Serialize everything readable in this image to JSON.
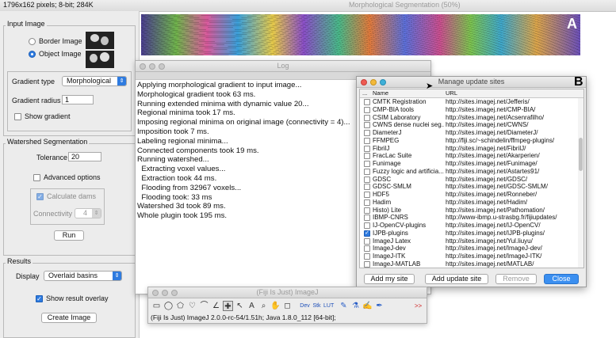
{
  "image_window": {
    "info_bar": "1796x162 pixels; 8-bit; 284K",
    "title": "Morphological Segmentation (50%)",
    "panel_letter": "A"
  },
  "input_image": {
    "section_title": "Input Image",
    "border_image_label": "Border Image",
    "object_image_label": "Object Image",
    "selected": "Object Image",
    "gradient_type_label": "Gradient type",
    "gradient_type_value": "Morphological",
    "gradient_radius_label": "Gradient radius",
    "gradient_radius_value": "1",
    "show_gradient_label": "Show gradient",
    "show_gradient_checked": false
  },
  "watershed": {
    "section_title": "Watershed Segmentation",
    "tolerance_label": "Tolerance",
    "tolerance_value": "20",
    "advanced_options_label": "Advanced options",
    "advanced_options_checked": false,
    "calculate_dams_label": "Calculate dams",
    "calculate_dams_checked": true,
    "connectivity_label": "Connectivity",
    "connectivity_value": "4",
    "run_label": "Run"
  },
  "results": {
    "section_title": "Results",
    "display_label": "Display",
    "display_value": "Overlaid basins",
    "show_overlay_label": "Show result overlay",
    "show_overlay_checked": true,
    "create_image_label": "Create Image"
  },
  "log_window": {
    "title": "Log",
    "lines": [
      "Applying morphological gradient to input image...",
      "Morphological gradient took 63 ms.",
      "Running extended minima with dynamic value 20...",
      "Regional minima took 17 ms.",
      "Imposing regional minima on original image (connectivity = 4)...",
      "Imposition took 7 ms.",
      "Labeling regional minima...",
      "Connected components took 19 ms.",
      "Running watershed...",
      "  Extracting voxel values...",
      "  Extraction took 44 ms.",
      "  Flooding from 32967 voxels...",
      "  Flooding took: 33 ms",
      "Watershed 3d took 89 ms.",
      "Whole plugin took 195 ms."
    ]
  },
  "update_sites": {
    "title": "Manage update sites",
    "panel_letter": "B",
    "col_check": "...",
    "col_name": "Name",
    "col_url": "URL",
    "rows": [
      {
        "name": "CMTK Registration",
        "url": "http://sites.imagej.net/Jefferis/",
        "checked": false
      },
      {
        "name": "CMP-BIA tools",
        "url": "http://sites.imagej.net/CMP-BIA/",
        "checked": false
      },
      {
        "name": "CSIM Laboratory",
        "url": "http://sites.imagej.net/Acsenrafilho/",
        "checked": false
      },
      {
        "name": "CWNS dense nuclei seg...",
        "url": "http://sites.imagej.net/CWNS/",
        "checked": false
      },
      {
        "name": "DiameterJ",
        "url": "http://sites.imagej.net/DiameterJ/",
        "checked": false
      },
      {
        "name": "FFMPEG",
        "url": "http://fiji.sc/~schindelin/ffmpeg-plugins/",
        "checked": false
      },
      {
        "name": "FibrilJ",
        "url": "http://sites.imagej.net/FibrilJ/",
        "checked": false
      },
      {
        "name": "FracLac Suite",
        "url": "http://sites.imagej.net/Akarperien/",
        "checked": false
      },
      {
        "name": "Funimage",
        "url": "http://sites.imagej.net/Funimage/",
        "checked": false
      },
      {
        "name": "Fuzzy logic and artificia...",
        "url": "http://sites.imagej.net/Astartes91/",
        "checked": false
      },
      {
        "name": "GDSC",
        "url": "http://sites.imagej.net/GDSC/",
        "checked": false
      },
      {
        "name": "GDSC-SMLM",
        "url": "http://sites.imagej.net/GDSC-SMLM/",
        "checked": false
      },
      {
        "name": "HDF5",
        "url": "http://sites.imagej.net/Ronneber/",
        "checked": false
      },
      {
        "name": "Hadim",
        "url": "http://sites.imagej.net/Hadim/",
        "checked": false
      },
      {
        "name": "Histo) Lite",
        "url": "http://sites.imagej.net/Pathomation/",
        "checked": false
      },
      {
        "name": "IBMP-CNRS",
        "url": "http://www-ibmp.u-strasbg.fr/fijiupdates/",
        "checked": false
      },
      {
        "name": "IJ-OpenCV-plugins",
        "url": "http://sites.imagej.net/IJ-OpenCV/",
        "checked": false
      },
      {
        "name": "IJPB-plugins",
        "url": "http://sites.imagej.net/IJPB-plugins/",
        "checked": true
      },
      {
        "name": "ImageJ Latex",
        "url": "http://sites.imagej.net/Yul.liuyu/",
        "checked": false
      },
      {
        "name": "ImageJ-dev",
        "url": "http://sites.imagej.net/ImageJ-dev/",
        "checked": false
      },
      {
        "name": "ImageJ-ITK",
        "url": "http://sites.imagej.net/ImageJ-ITK/",
        "checked": false
      },
      {
        "name": "ImageJ-MATLAB",
        "url": "http://sites.imagej.net/MATLAB/",
        "checked": false
      }
    ],
    "add_my_site_label": "Add my site",
    "add_update_site_label": "Add update site",
    "remove_label": "Remove",
    "close_label": "Close"
  },
  "imagej_window": {
    "title": "(Fiji Is Just) ImageJ",
    "status": "(Fiji Is Just) ImageJ 2.0.0-rc-54/1.51h; Java 1.8.0_112 [64-bit];",
    "tool_labels": {
      "dev": "Dev",
      "stk": "Stk",
      "lut": "LUT",
      "more": ">>"
    }
  },
  "colors": {
    "accent": "#2e7be0",
    "close_button": "#3b8ff0",
    "panel_bg": "#ececec"
  }
}
